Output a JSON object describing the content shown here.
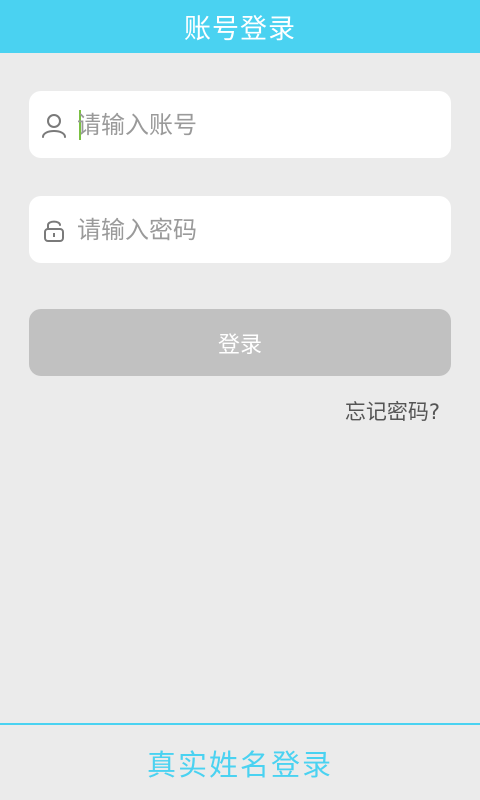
{
  "header": {
    "title": "账号登录"
  },
  "form": {
    "account": {
      "icon": "user-icon",
      "placeholder": "请输入账号",
      "value": ""
    },
    "password": {
      "icon": "lock-icon",
      "placeholder": "请输入密码",
      "value": ""
    },
    "login_label": "登录",
    "forgot_label": "忘记密码?"
  },
  "footer": {
    "real_name_login_label": "真实姓名登录"
  },
  "colors": {
    "accent": "#4ad2f1",
    "background": "#ebebeb",
    "button_disabled": "#c1c1c1",
    "cursor": "#7bc142"
  }
}
